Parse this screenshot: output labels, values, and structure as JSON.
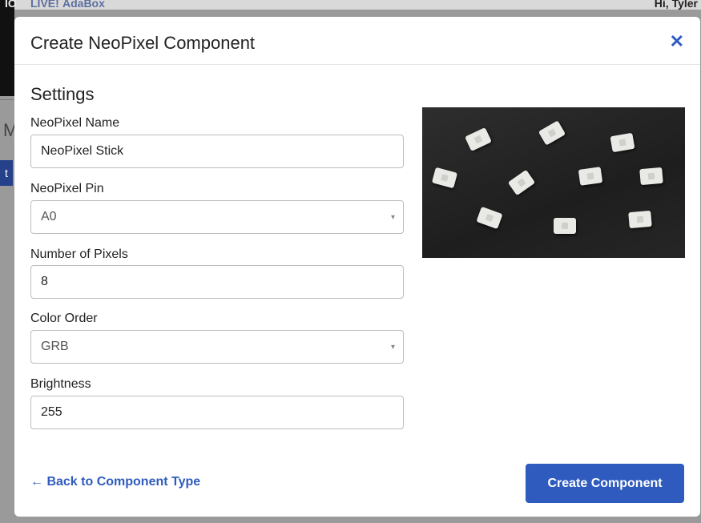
{
  "background": {
    "io_label": "IO",
    "live_label": "LIVE!",
    "adabox_label": "AdaBox",
    "greeting": "Hi, Tyler",
    "partial_heading": "M",
    "partial_button": "t"
  },
  "modal": {
    "title": "Create NeoPixel Component",
    "close_glyph": "✕",
    "section_title": "Settings",
    "fields": {
      "name": {
        "label": "NeoPixel Name",
        "value": "NeoPixel Stick"
      },
      "pin": {
        "label": "NeoPixel Pin",
        "selected": "A0"
      },
      "pixels": {
        "label": "Number of Pixels",
        "value": "8"
      },
      "color_order": {
        "label": "Color Order",
        "selected": "GRB"
      },
      "brightness": {
        "label": "Brightness",
        "value": "255"
      }
    },
    "caret_glyph": "▾",
    "back_link": "← Back to Component Type",
    "create_button": "Create Component"
  },
  "colors": {
    "accent": "#2f5bbf"
  }
}
